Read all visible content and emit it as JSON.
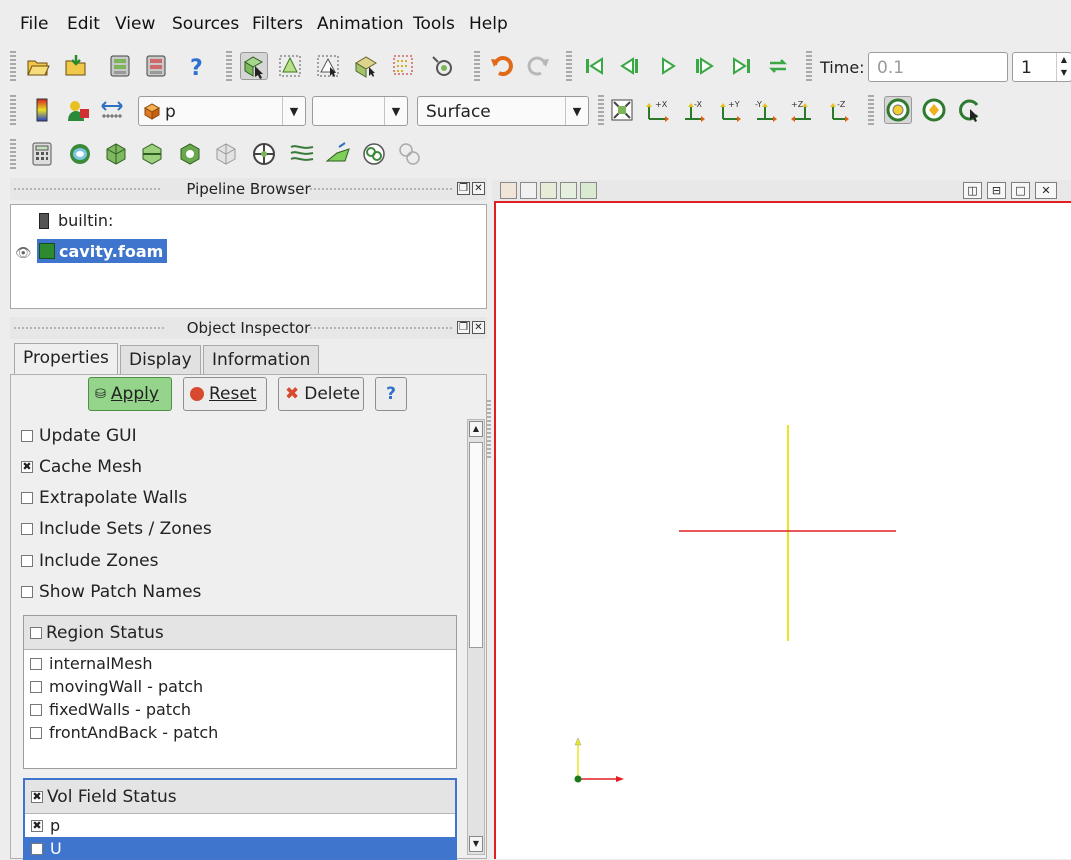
{
  "menu": [
    "File",
    "Edit",
    "View",
    "Sources",
    "Filters",
    "Animation",
    "Tools",
    "Help"
  ],
  "toolbar_main": {
    "icons": [
      "open-file-icon",
      "save-state-icon",
      "connect-icon",
      "disconnect-icon",
      "help-icon",
      "select-cells-icon",
      "select-points-icon",
      "select-frustum-icon",
      "select-block-icon",
      "select-points-through-icon",
      "interactive-select-icon",
      "undo-icon",
      "redo-icon",
      "first-frame-icon",
      "previous-frame-icon",
      "play-icon",
      "next-frame-icon",
      "last-frame-icon",
      "loop-icon"
    ],
    "time_label": "Time:",
    "time_value": "0.1",
    "time_step": "1"
  },
  "toolbar_display": {
    "color_variable": "p",
    "color_component": "",
    "representation": "Surface",
    "camera_buttons": [
      "reset-camera-icon",
      "view-plus-x-icon",
      "view-minus-x-icon",
      "view-plus-y-icon",
      "view-minus-y-icon",
      "view-plus-z-icon",
      "view-minus-z-icon",
      "show-center-icon",
      "reset-center-icon",
      "pick-center-icon"
    ]
  },
  "toolbar_filters": [
    "calculator-icon",
    "contour-icon",
    "clip-icon",
    "slice-icon",
    "threshold-icon",
    "extract-subset-icon",
    "glyph-icon",
    "stream-tracer-icon",
    "warp-vector-icon",
    "group-datasets-icon",
    "extract-level-icon"
  ],
  "pipeline": {
    "title": "Pipeline Browser",
    "root": "builtin:",
    "source": "cavity.foam"
  },
  "inspector": {
    "title": "Object Inspector",
    "tabs": [
      "Properties",
      "Display",
      "Information"
    ],
    "apply": "Apply",
    "reset": "Reset",
    "delete": "Delete",
    "help": "?",
    "options": [
      {
        "label": "Update GUI",
        "checked": false
      },
      {
        "label": "Cache Mesh",
        "checked": true
      },
      {
        "label": "Extrapolate Walls",
        "checked": false
      },
      {
        "label": "Include Sets / Zones",
        "checked": false
      },
      {
        "label": "Include Zones",
        "checked": false
      },
      {
        "label": "Show Patch Names",
        "checked": false
      }
    ],
    "region_status": {
      "header": "Region Status",
      "items": [
        "internalMesh",
        "movingWall - patch",
        "fixedWalls - patch",
        "frontAndBack - patch"
      ]
    },
    "vol_field_status": {
      "header": "Vol Field Status",
      "items": [
        "p",
        "U"
      ]
    }
  },
  "colors": {
    "selection": "#3f75cc",
    "active_view_border": "#e02020",
    "apply_button": "#95d48b",
    "axis_x": "#e02020",
    "axis_y": "#e8e820"
  }
}
